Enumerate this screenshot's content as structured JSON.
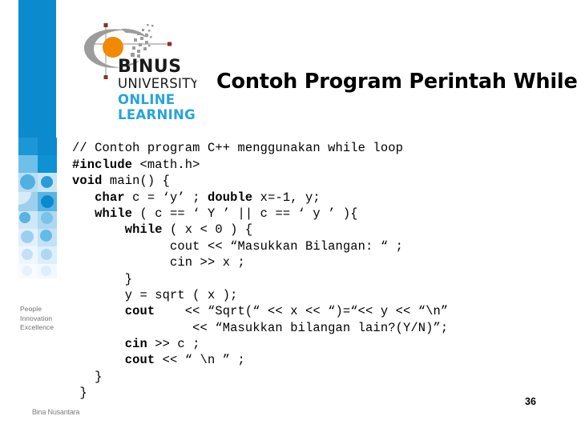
{
  "slide": {
    "title": "Contoh Program Perintah While",
    "page_number": "36",
    "footer_brand": "Bina Nusantara",
    "background_color": "#ffffff"
  },
  "logo": {
    "name_primary": "BINUS",
    "name_secondary": "UNIVERSITY",
    "name_tertiary_line1": "ONLINE",
    "name_tertiary_line2": "LEARNING",
    "swoosh_color": "#9c9c9c",
    "dot_color": "#f18a00",
    "crosshair_color": "#8a2f2f",
    "text_color": "#1a1a1a",
    "accent_color": "#29a3dc"
  },
  "sidebar": {
    "tagline_line1": "People",
    "tagline_line2": "Innovation",
    "tagline_line3": "Excellence",
    "band_color": "#0b8bce",
    "tagline_color": "#6f6f6f"
  },
  "code": {
    "language": "cpp",
    "lines": [
      {
        "indent": 0,
        "segments": [
          {
            "text": "// Contoh program C++ menggunakan while loop",
            "bold": false
          }
        ]
      },
      {
        "indent": 0,
        "segments": [
          {
            "text": "#include",
            "bold": true
          },
          {
            "text": " <math.h>",
            "bold": false
          }
        ]
      },
      {
        "indent": 0,
        "segments": [
          {
            "text": "void",
            "bold": true
          },
          {
            "text": " main() {",
            "bold": false
          }
        ]
      },
      {
        "indent": 0,
        "segments": [
          {
            "text": "   ",
            "bold": false
          },
          {
            "text": "char",
            "bold": true
          },
          {
            "text": " c = ‘y’ ; ",
            "bold": false
          },
          {
            "text": "double",
            "bold": true
          },
          {
            "text": " x=-1, y;",
            "bold": false
          }
        ]
      },
      {
        "indent": 0,
        "segments": [
          {
            "text": "   ",
            "bold": false
          },
          {
            "text": "while",
            "bold": true
          },
          {
            "text": " ( c == ‘ Y ’ || c == ‘ y ’ ){",
            "bold": false
          }
        ]
      },
      {
        "indent": 0,
        "segments": [
          {
            "text": "       ",
            "bold": false
          },
          {
            "text": "while",
            "bold": true
          },
          {
            "text": " ( x < 0 ) {",
            "bold": false
          }
        ]
      },
      {
        "indent": 0,
        "segments": [
          {
            "text": "             cout << “Masukkan Bilangan: “ ;",
            "bold": false
          }
        ]
      },
      {
        "indent": 0,
        "segments": [
          {
            "text": "             cin >> x ;",
            "bold": false
          }
        ]
      },
      {
        "indent": 0,
        "segments": [
          {
            "text": "       }",
            "bold": false
          }
        ]
      },
      {
        "indent": 0,
        "segments": [
          {
            "text": "       y = sqrt ( x );",
            "bold": false
          }
        ]
      },
      {
        "indent": 0,
        "segments": [
          {
            "text": "       ",
            "bold": false
          },
          {
            "text": "cout",
            "bold": true
          },
          {
            "text": "    << “Sqrt(“ << x << “)=“<< y << “\\n”",
            "bold": false
          }
        ]
      },
      {
        "indent": 0,
        "segments": [
          {
            "text": "                << “Masukkan bilangan lain?(Y/N)”;",
            "bold": false
          }
        ]
      },
      {
        "indent": 0,
        "segments": [
          {
            "text": "       ",
            "bold": false
          },
          {
            "text": "cin",
            "bold": true
          },
          {
            "text": " >> c ;",
            "bold": false
          }
        ]
      },
      {
        "indent": 0,
        "segments": [
          {
            "text": "       ",
            "bold": false
          },
          {
            "text": "cout",
            "bold": true
          },
          {
            "text": " << “ \\n ” ;",
            "bold": false
          }
        ]
      },
      {
        "indent": 0,
        "segments": [
          {
            "text": "   }",
            "bold": false
          }
        ]
      },
      {
        "indent": 0,
        "segments": [
          {
            "text": " }",
            "bold": false
          }
        ]
      }
    ]
  }
}
